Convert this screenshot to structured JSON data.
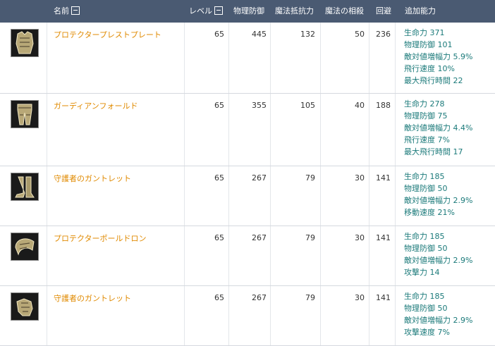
{
  "header": {
    "name": "名前",
    "level": "レベル",
    "pdef": "物理防御",
    "mres": "魔法抵抗力",
    "mdef": "魔法の相殺",
    "eva": "回避",
    "extra": "追加能力"
  },
  "colors": {
    "header_bg": "#4a5a72",
    "name": "#e08a00",
    "bonus": "#1b7a7a"
  },
  "rows": [
    {
      "icon": "chest-armor-icon",
      "name": "プロテクタープレストプレート",
      "level": "65",
      "pdef": "445",
      "mres": "132",
      "mdef": "50",
      "eva": "236",
      "bonus": [
        "生命力 371",
        "物理防御 101",
        "敵対値増幅力 5.9%",
        "飛行速度 10%",
        "最大飛行時間 22"
      ]
    },
    {
      "icon": "pants-armor-icon",
      "name": "ガーディアンフォールド",
      "level": "65",
      "pdef": "355",
      "mres": "105",
      "mdef": "40",
      "eva": "188",
      "bonus": [
        "生命力 278",
        "物理防御 75",
        "敵対値増幅力 4.4%",
        "飛行速度 7%",
        "最大飛行時間 17"
      ]
    },
    {
      "icon": "boots-armor-icon",
      "name": "守護者のガントレット",
      "level": "65",
      "pdef": "267",
      "mres": "79",
      "mdef": "30",
      "eva": "141",
      "bonus": [
        "生命力 185",
        "物理防御 50",
        "敵対値増幅力 2.9%",
        "移動速度 21%"
      ]
    },
    {
      "icon": "shoulder-armor-icon",
      "name": "プロテクターポールドロン",
      "level": "65",
      "pdef": "267",
      "mres": "79",
      "mdef": "30",
      "eva": "141",
      "bonus": [
        "生命力 185",
        "物理防御 50",
        "敵対値増幅力 2.9%",
        "攻撃力 14"
      ]
    },
    {
      "icon": "gloves-armor-icon",
      "name": "守護者のガントレット",
      "level": "65",
      "pdef": "267",
      "mres": "79",
      "mdef": "30",
      "eva": "141",
      "bonus": [
        "生命力 185",
        "物理防御 50",
        "敵対値増幅力 2.9%",
        "攻撃速度 7%"
      ]
    }
  ]
}
